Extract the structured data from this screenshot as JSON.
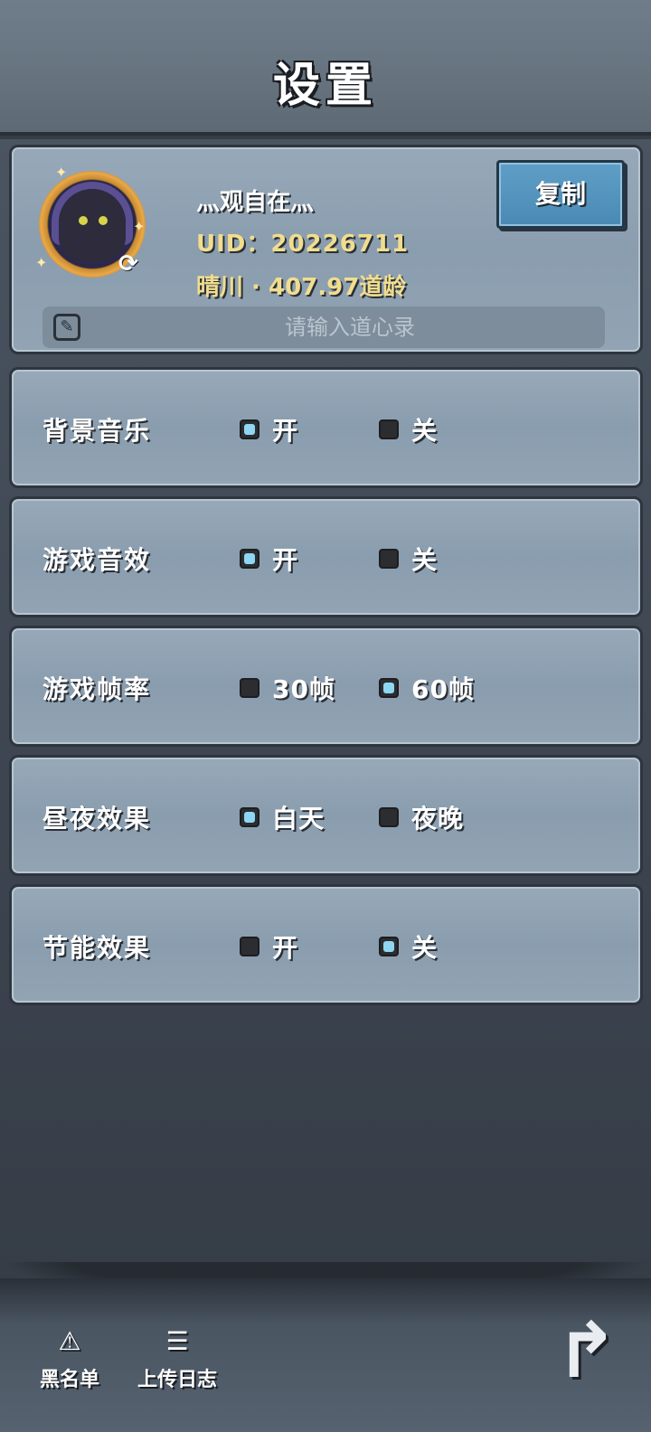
{
  "header": {
    "title": "设置"
  },
  "profile": {
    "nickname": "灬观自在灬",
    "uid": "UID：20226711",
    "realm": "晴川 · 407.97道龄",
    "copy_label": "复制",
    "motto_placeholder": "请输入道心录",
    "swap_icon": "refresh-icon"
  },
  "settings": [
    {
      "label": "背景音乐",
      "options": [
        "开",
        "关"
      ],
      "selected": 0
    },
    {
      "label": "游戏音效",
      "options": [
        "开",
        "关"
      ],
      "selected": 0
    },
    {
      "label": "游戏帧率",
      "options": [
        "30帧",
        "60帧"
      ],
      "selected": 1
    },
    {
      "label": "昼夜效果",
      "options": [
        "白天",
        "夜晚"
      ],
      "selected": 0
    },
    {
      "label": "节能效果",
      "options": [
        "开",
        "关"
      ],
      "selected": 1
    }
  ],
  "footer": {
    "blacklist_label": "黑名单",
    "upload_log_label": "上传日志",
    "back_icon": "back-arrow-icon"
  },
  "colors": {
    "accent_checked": "#8fd6f2",
    "copy_button": "#4a89b3",
    "gold_text": "#f0dd8e"
  }
}
